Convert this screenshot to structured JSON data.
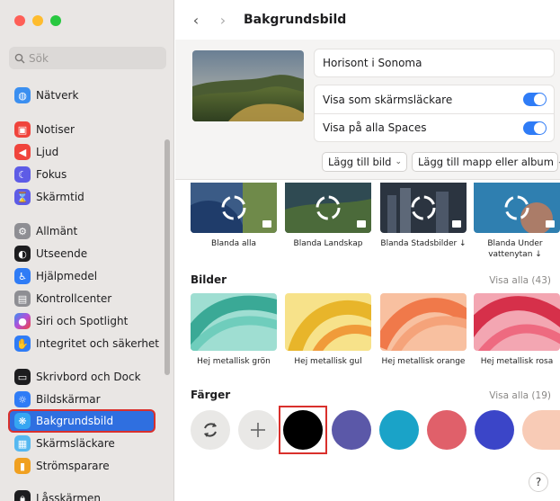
{
  "window": {
    "traffic_lights": [
      "#fe5f57",
      "#febc2e",
      "#28c840"
    ]
  },
  "search": {
    "placeholder": "Sök"
  },
  "sidebar": {
    "items": [
      {
        "label": "Nätverk",
        "icon": "globe-icon",
        "color": "#3b8ff0"
      },
      {
        "label": "Notiser",
        "icon": "bell-icon",
        "color": "#f0443c"
      },
      {
        "label": "Ljud",
        "icon": "speaker-icon",
        "color": "#f0443c"
      },
      {
        "label": "Fokus",
        "icon": "moon-icon",
        "color": "#5e5ce6"
      },
      {
        "label": "Skärmtid",
        "icon": "hourglass-icon",
        "color": "#5e5ce6"
      },
      {
        "label": "Allmänt",
        "icon": "gear-icon",
        "color": "#8e8e93"
      },
      {
        "label": "Utseende",
        "icon": "appearance-icon",
        "color": "#1d1d1f"
      },
      {
        "label": "Hjälpmedel",
        "icon": "accessibility-icon",
        "color": "#2f7cf6"
      },
      {
        "label": "Kontrollcenter",
        "icon": "control-center-icon",
        "color": "#8e8e93"
      },
      {
        "label": "Siri och Spotlight",
        "icon": "siri-icon",
        "color": "#b44fd8"
      },
      {
        "label": "Integritet och säkerhet",
        "icon": "hand-icon",
        "color": "#2f7cf6"
      },
      {
        "label": "Skrivbord och Dock",
        "icon": "dock-icon",
        "color": "#1d1d1f"
      },
      {
        "label": "Bildskärmar",
        "icon": "sun-icon",
        "color": "#2f7cf6"
      },
      {
        "label": "Bakgrundsbild",
        "icon": "flower-icon",
        "color": "#36a6f2"
      },
      {
        "label": "Skärmsläckare",
        "icon": "screensaver-icon",
        "color": "#55b8f0"
      },
      {
        "label": "Strömsparare",
        "icon": "battery-icon",
        "color": "#f0a020"
      },
      {
        "label": "Låsskärmen",
        "icon": "lock-icon",
        "color": "#1d1d1f"
      }
    ]
  },
  "header": {
    "title": "Bakgrundsbild"
  },
  "current": {
    "name": "Horisont i Sonoma",
    "screensaver_label": "Visa som skärmsläckare",
    "screensaver_on": true,
    "spaces_label": "Visa på alla Spaces",
    "spaces_on": true,
    "add_picture": "Lägg till bild",
    "add_folder": "Lägg till mapp eller album"
  },
  "dynamic": [
    {
      "label": "Blanda alla"
    },
    {
      "label": "Blanda Landskap"
    },
    {
      "label": "Blanda Stadsbilder ↓"
    },
    {
      "label": "Blanda Under vattenytan ↓"
    }
  ],
  "pictures": {
    "title": "Bilder",
    "show_all": "Visa alla (43)",
    "items": [
      {
        "label": "Hej metallisk grön",
        "color": "#4cb8a8"
      },
      {
        "label": "Hej metallisk gul",
        "color": "#f0c93a"
      },
      {
        "label": "Hej metallisk orange",
        "color": "#f58a5a"
      },
      {
        "label": "Hej metallisk rosa",
        "color": "#e8415a"
      }
    ]
  },
  "colors": {
    "title": "Färger",
    "show_all": "Visa alla (19)",
    "swatches": [
      "#000000",
      "#5b58a8",
      "#1aa3c8",
      "#e0606a",
      "#3b45c8",
      "#f8cbb6"
    ]
  },
  "help": "?"
}
